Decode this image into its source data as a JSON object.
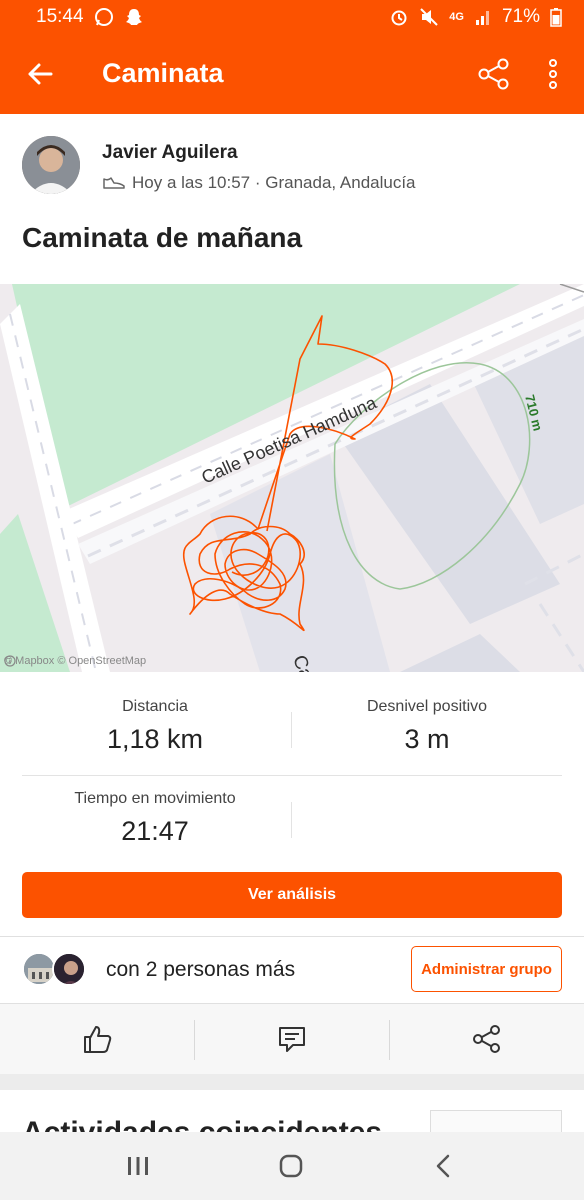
{
  "status_bar": {
    "time": "15:44",
    "network": "4G",
    "battery": "71%",
    "icons": [
      "whatsapp-icon",
      "snapchat-icon",
      "alarm-icon",
      "mute-icon",
      "signal-icon",
      "battery-icon"
    ]
  },
  "app_bar": {
    "title": "Caminata",
    "back_icon": "arrow-left-icon",
    "share_icon": "share-icon",
    "more_icon": "more-vertical-icon"
  },
  "athlete": {
    "name": "Javier Aguilera",
    "meta": "Hoy a las 10:57 · Granada, Andalucía",
    "meta_icon": "shoe-icon"
  },
  "activity": {
    "title": "Caminata de mañana"
  },
  "map": {
    "street_1": "Calle Poetisa Hamduna",
    "street_2": "Calle Joaquina Egua",
    "contour_label": "710 m",
    "attribution": "© Mapbox © OpenStreetMap"
  },
  "stats": {
    "distance_label": "Distancia",
    "distance_value": "1,18 km",
    "elevation_label": "Desnivel positivo",
    "elevation_value": "3 m",
    "moving_time_label": "Tiempo en movimiento",
    "moving_time_value": "21:47"
  },
  "analysis_button": "Ver análisis",
  "group": {
    "text": "con 2 personas más",
    "manage_button": "Administrar grupo"
  },
  "social": {
    "icons": [
      "thumbs-up-icon",
      "comment-icon",
      "share-icon"
    ]
  },
  "matching": {
    "title": "Actividades coincidentes"
  },
  "nav_bar": {
    "icons": [
      "recents-icon",
      "home-icon",
      "back-icon"
    ]
  },
  "colors": {
    "brand": "#fc5200",
    "route": "#fc5200",
    "park": "#c8ecc8"
  }
}
